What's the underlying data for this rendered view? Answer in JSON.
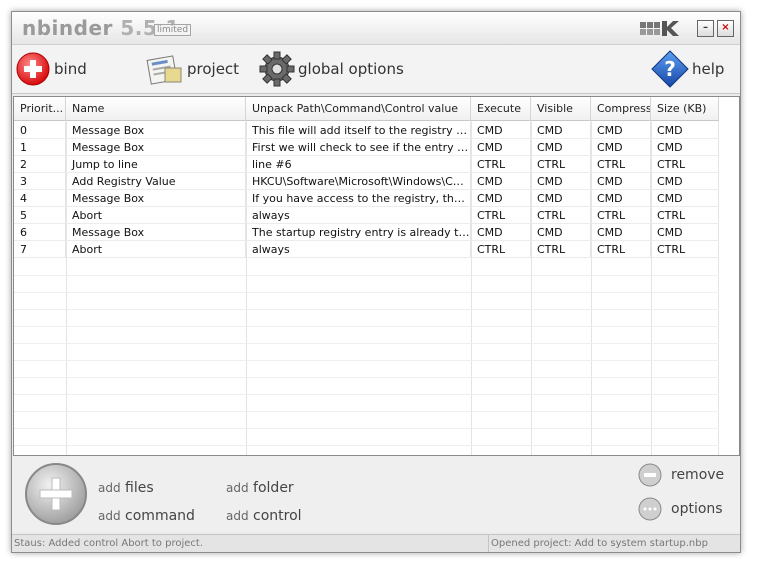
{
  "title": {
    "name": "nbinder",
    "version": "5.5.1",
    "edition": "limited"
  },
  "toolbar": {
    "bind": "bind",
    "project": "project",
    "global_options": "global options",
    "help": "help"
  },
  "table": {
    "columns": [
      "Priorit...",
      "Name",
      "Unpack Path\\Command\\Control value",
      "Execute",
      "Visible",
      "Compress",
      "Size (KB)"
    ],
    "rows": [
      [
        "0",
        "Message Box",
        "This file will add itself to the registry startup l...",
        "CMD",
        "CMD",
        "CMD",
        "CMD"
      ],
      [
        "1",
        "Message Box",
        "First we will check to see if the entry alread...",
        "CMD",
        "CMD",
        "CMD",
        "CMD"
      ],
      [
        "2",
        "Jump to line",
        "line #6",
        "CTRL",
        "CTRL",
        "CTRL",
        "CTRL"
      ],
      [
        "3",
        "Add Registry Value",
        "HKCU\\Software\\Microsoft\\Windows\\Curre...",
        "CMD",
        "CMD",
        "CMD",
        "CMD"
      ],
      [
        "4",
        "Message Box",
        "If you have access to the registry, the regis...",
        "CMD",
        "CMD",
        "CMD",
        "CMD"
      ],
      [
        "5",
        "Abort",
        "always",
        "CTRL",
        "CTRL",
        "CTRL",
        "CTRL"
      ],
      [
        "6",
        "Message Box",
        "The startup registry entry is already there. ...",
        "CMD",
        "CMD",
        "CMD",
        "CMD"
      ],
      [
        "7",
        "Abort",
        "always",
        "CTRL",
        "CTRL",
        "CTRL",
        "CTRL"
      ]
    ]
  },
  "bottom": {
    "add_prefix": "add",
    "files": "files",
    "folder": "folder",
    "command": "command",
    "control": "control",
    "remove": "remove",
    "options": "options"
  },
  "status": {
    "left": "Staus: Added control Abort to project.",
    "right": "Opened project: Add to system startup.nbp"
  },
  "colors": {
    "bind_accent": "#e02020",
    "help_accent": "#1e5fc8",
    "window_bg": "#ececec"
  },
  "icons": [
    "plus-circle-icon",
    "project-icon",
    "gear-icon",
    "help-diamond-icon",
    "minus-circle-icon",
    "options-circle-icon"
  ]
}
